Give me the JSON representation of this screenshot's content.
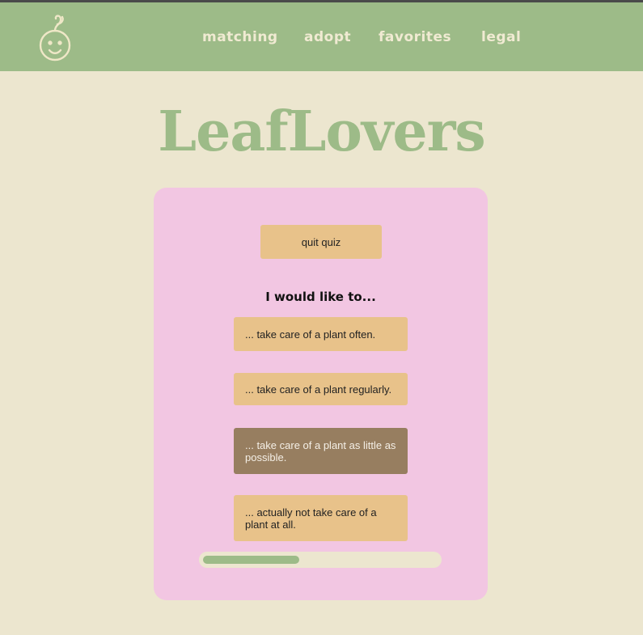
{
  "nav": {
    "logo_icon": "baby-sprout-icon",
    "links": [
      {
        "label": "matching"
      },
      {
        "label": "adopt"
      },
      {
        "label": "favorites"
      },
      {
        "label": "legal"
      }
    ]
  },
  "brand": {
    "title": "LeafLovers"
  },
  "quiz": {
    "quit_label": "quit quiz",
    "question": "I would like to...",
    "options": [
      {
        "label": "... take care of a plant often.",
        "selected": false
      },
      {
        "label": "... take care of a plant regularly.",
        "selected": false
      },
      {
        "label": "... take care of a plant as little as possible.",
        "selected": true
      },
      {
        "label": "... actually not take care of a plant at all.",
        "selected": false
      }
    ],
    "progress": 0.41
  },
  "colors": {
    "nav_bg": "#9dbb88",
    "page_bg": "#ece6cf",
    "card_bg": "#f2c6e2",
    "option_bg": "#e8c28a",
    "option_selected_bg": "#977e60"
  }
}
